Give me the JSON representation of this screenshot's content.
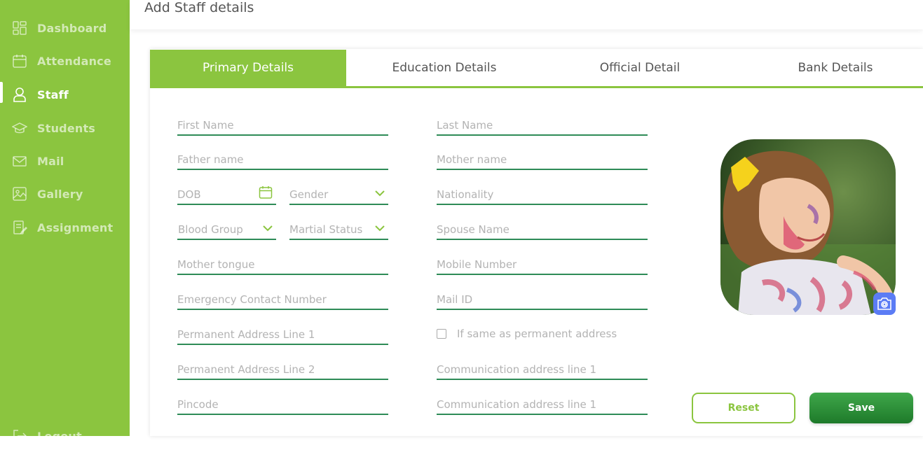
{
  "sidebar": {
    "items": [
      {
        "label": "Dashboard",
        "icon": "dashboard-icon"
      },
      {
        "label": "Attendance",
        "icon": "calendar-icon"
      },
      {
        "label": "Staff",
        "icon": "user-icon",
        "active": true
      },
      {
        "label": "Students",
        "icon": "graduation-cap-icon"
      },
      {
        "label": "Mail",
        "icon": "mail-icon"
      },
      {
        "label": "Gallery",
        "icon": "gallery-icon"
      },
      {
        "label": "Assignment",
        "icon": "assignment-icon"
      }
    ],
    "logout_label": "Logout"
  },
  "header": {
    "title": "Add Staff details"
  },
  "tabs": [
    {
      "label": "Primary Details",
      "active": true
    },
    {
      "label": "Education Details"
    },
    {
      "label": "Official Detail"
    },
    {
      "label": "Bank Details"
    }
  ],
  "form": {
    "first_name": "First Name",
    "last_name": "Last Name",
    "father_name": "Father name",
    "mother_name": "Mother name",
    "dob": "DOB",
    "gender": "Gender",
    "nationality": "Nationality",
    "blood_group": "Blood Group",
    "marital_status": "Martial Status",
    "spouse_name": "Spouse Name",
    "mother_tongue": "Mother tongue",
    "mobile_number": "Mobile Number",
    "emergency_contact": "Emergency Contact Number",
    "mail_id": "Mail ID",
    "perm_addr_1": "Permanent Address Line 1",
    "same_as_perm": "If same as permanent  address",
    "perm_addr_2": "Permanent Address Line 2",
    "comm_addr_1": "Communication address line 1",
    "pincode": "Pincode",
    "comm_addr_2": "Communication address line 1"
  },
  "buttons": {
    "reset": "Reset",
    "save": "Save"
  },
  "colors": {
    "accent": "#8bc53f",
    "underline": "#2e8b57",
    "camera": "#5b7cf5"
  }
}
